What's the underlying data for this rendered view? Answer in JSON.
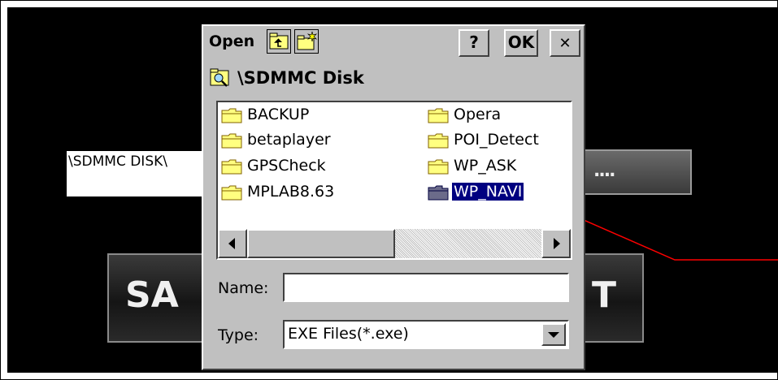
{
  "background": {
    "path_field_value": "\\SDMMC DISK\\",
    "browse_button_label": "....",
    "save_button_label": "SA",
    "right_button_label": "T"
  },
  "dialog": {
    "title": "Open",
    "help_label": "?",
    "ok_label": "OK",
    "close_label": "✕",
    "current_path": "\\SDMMC Disk",
    "folders_left": [
      "BACKUP",
      "betaplayer",
      "GPSCheck",
      "MPLAB8.63"
    ],
    "folders_right": [
      "Opera",
      "POI_Detect",
      "WP_ASK",
      "WP_NAVI"
    ],
    "selected_folder": "WP_NAVI",
    "name_label": "Name:",
    "name_value": "",
    "type_label": "Type:",
    "type_value": "EXE Files(*.exe)"
  },
  "colors": {
    "selection": "#000080",
    "annotation_line": "#ff0000",
    "dialog_face": "#c0c0c0"
  },
  "icons": [
    "up-folder-icon",
    "new-folder-icon",
    "drive-icon",
    "folder-icon",
    "scroll-left-icon",
    "scroll-right-icon",
    "dropdown-arrow-icon"
  ]
}
